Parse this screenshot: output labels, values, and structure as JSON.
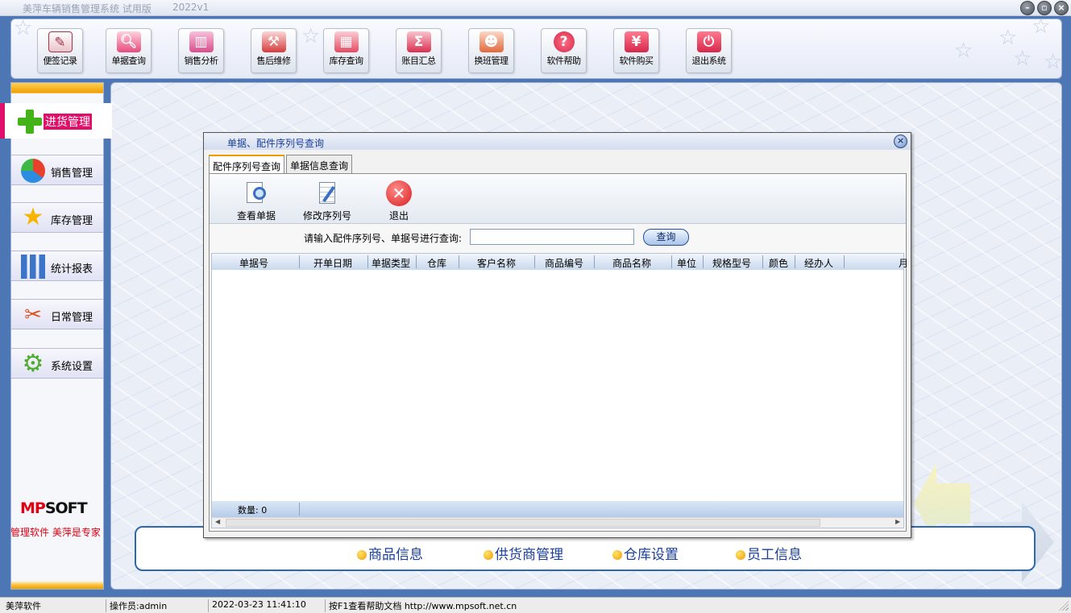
{
  "window": {
    "title": "美萍车辆销售管理系统 试用版",
    "version": "2022v1",
    "controls": [
      "minimize-icon",
      "restore-icon",
      "close-icon"
    ]
  },
  "toolbar": {
    "buttons": [
      {
        "label": "便签记录",
        "icon": "notepad-icon",
        "color": "#d9364b"
      },
      {
        "label": "单据查询",
        "icon": "magnifier-icon",
        "color": "#e64c7d"
      },
      {
        "label": "销售分析",
        "icon": "bar-chart-icon",
        "color": "#d94d8a"
      },
      {
        "label": "售后维修",
        "icon": "screwdriver-icon",
        "color": "#d63c3c"
      },
      {
        "label": "库存查询",
        "icon": "boxes-icon",
        "color": "#e54b63"
      },
      {
        "label": "账目汇总",
        "icon": "sigma-icon",
        "color": "#d9304f"
      },
      {
        "label": "换班管理",
        "icon": "users-icon",
        "color": "#e0693d"
      },
      {
        "label": "软件帮助",
        "icon": "help-icon",
        "color": "#d6284a"
      },
      {
        "label": "软件购买",
        "icon": "yen-icon",
        "color": "#d6284a"
      },
      {
        "label": "退出系统",
        "icon": "power-icon",
        "color": "#d6284a"
      }
    ]
  },
  "sidebar": {
    "active": {
      "label": "进货管理",
      "icon": "plus-icon"
    },
    "items": [
      {
        "label": "销售管理",
        "icon": "pie-chart-icon"
      },
      {
        "label": "库存管理",
        "icon": "star-icon"
      },
      {
        "label": "统计报表",
        "icon": "bar-chart-icon"
      },
      {
        "label": "日常管理",
        "icon": "tools-icon"
      },
      {
        "label": "系统设置",
        "icon": "gear-icon"
      }
    ],
    "logo": {
      "prefix": "MP",
      "suffix": "SOFT"
    },
    "slogan": "管理软件 美萍是专家"
  },
  "infobar": {
    "links": [
      "商品信息",
      "供货商管理",
      "仓库设置",
      "员工信息"
    ]
  },
  "dialog": {
    "title": "单据、配件序列号查询",
    "tabs": [
      "配件序列号查询",
      "单据信息查询"
    ],
    "actions": [
      {
        "label": "查看单据",
        "icon": "view-document-icon"
      },
      {
        "label": "修改序列号",
        "icon": "edit-notepad-icon"
      },
      {
        "label": "退出",
        "icon": "exit-icon"
      }
    ],
    "search": {
      "label": "请输入配件序列号、单据号进行查询:",
      "value": "",
      "button": "查询"
    },
    "grid": {
      "columns": [
        "单据号",
        "开单日期",
        "单据类型",
        "仓库",
        "客户名称",
        "商品编号",
        "商品名称",
        "单位",
        "规格型号",
        "颜色",
        "经办人",
        "月"
      ],
      "rows": [],
      "footer": "数量: 0"
    }
  },
  "statusbar": {
    "company": "美萍软件",
    "operator": "操作员:admin",
    "datetime": "2022-03-23 11:41:10",
    "help": "按F1查看帮助文档  http://www.mpsoft.net.cn"
  }
}
